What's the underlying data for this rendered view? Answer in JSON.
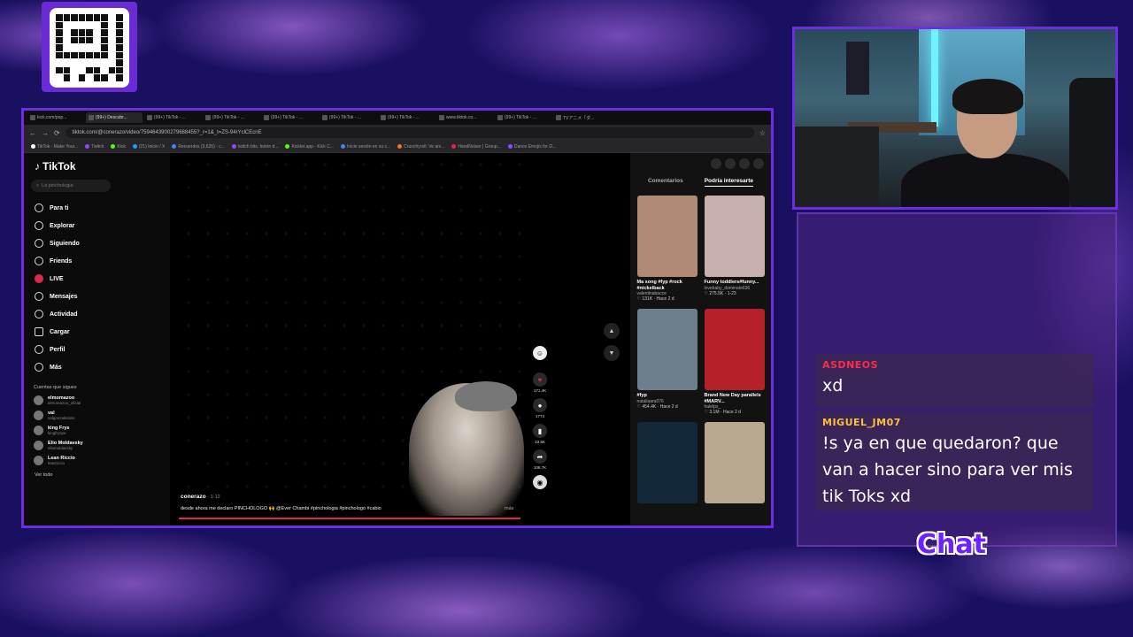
{
  "browser": {
    "tabs": [
      {
        "label": "kick.com/pop..."
      },
      {
        "label": "(99+) Descubr..."
      },
      {
        "label": "(99+) TikTok - ..."
      },
      {
        "label": "(99+) TikTok - ..."
      },
      {
        "label": "(99+) TikTok - ..."
      },
      {
        "label": "(99+) TikTok - ..."
      },
      {
        "label": "(99+) TikTok - ..."
      },
      {
        "label": "www.tiktok.co..."
      },
      {
        "label": "(99+) TikTok - ..."
      },
      {
        "label": "TVアニメ「ダ..."
      }
    ],
    "url": "tiktok.com/@conerazo/video/7594643900279688455?_r=1&_t=ZS-94rYclCEcnE",
    "bookmarks": [
      "TikTok - Make Your...",
      "Twitch",
      "Kick",
      "(21) Inicio / X",
      "Recuerdos (3,626) - c...",
      "twitch bits: botón d...",
      "Kicklet.app - Kick C...",
      "Inicie sesión en su c...",
      "Crunchyroll: Ve ani...",
      "HandNoiser | Group...",
      "Dance Emojis for D..."
    ]
  },
  "tiktok": {
    "logo": "TikTok",
    "search_placeholder": "La pinchologia",
    "menu": [
      {
        "label": "Para ti",
        "icon": "home-icon"
      },
      {
        "label": "Explorar",
        "icon": "compass-icon"
      },
      {
        "label": "Siguiendo",
        "icon": "following-icon"
      },
      {
        "label": "Friends",
        "icon": "friends-icon"
      },
      {
        "label": "LIVE",
        "icon": "live-icon"
      },
      {
        "label": "Mensajes",
        "icon": "messages-icon"
      },
      {
        "label": "Actividad",
        "icon": "activity-icon"
      },
      {
        "label": "Cargar",
        "icon": "upload-icon"
      },
      {
        "label": "Perfil",
        "icon": "profile-icon"
      },
      {
        "label": "Más",
        "icon": "more-icon"
      }
    ],
    "following_header": "Cuentas que sigues",
    "following": [
      {
        "name": "elmomazoo",
        "handle": "elmomazoo_oficial"
      },
      {
        "name": "val",
        "handle": "valgonzalessss"
      },
      {
        "name": "king Frys",
        "handle": "kingfryspe"
      },
      {
        "name": "Elio Moldavsky",
        "handle": "eliomoldavsky"
      },
      {
        "name": "Lean Riccio",
        "handle": "leanriccio"
      }
    ],
    "see_all": "Ver todo",
    "video": {
      "author": "conerazo",
      "date": "· 1-12",
      "caption": "desde ahora me declaro PINCHOLOGO 🙌 @Ever Chambi #pinchologia #pinchologo #cabio",
      "more": "más",
      "progress": 1.0,
      "likes": "171.4K",
      "comments": "1774",
      "saves": "33.5K",
      "shares": "108.7K"
    },
    "right_tabs": [
      "Comentarios",
      "Podría interesarte"
    ],
    "recommended": [
      {
        "title": "Ma song #fyp #rock #nickelback",
        "user": "valentinabacce",
        "likes": "131K",
        "age": "Hace 2 d",
        "color": "#b08a74"
      },
      {
        "title": "Funny toddlers#funny...",
        "user": "lovebaby_dominate636",
        "likes": "275.5K",
        "age": "1-23",
        "color": "#c7b0ad"
      },
      {
        "title": "#fyp",
        "user": "nataliaara076",
        "likes": "454.4K",
        "age": "Hace 2 d",
        "color": "#6e7f8c"
      },
      {
        "title": "Brand New Day parallels #MARV...",
        "user": "halelps_",
        "likes": "3.1M",
        "age": "Hace 2 d",
        "color": "#b5202a"
      },
      {
        "title": "",
        "user": "",
        "likes": "",
        "age": "",
        "color": "#14283c"
      },
      {
        "title": "",
        "user": "",
        "likes": "",
        "age": "",
        "color": "#b8a890"
      }
    ]
  },
  "chat": {
    "messages": [
      {
        "user": "ASDNEOS",
        "user_color": "#ff2b4b",
        "text": "xd"
      },
      {
        "user": "MIGUEL_JM07",
        "user_color": "#ffbf3a",
        "text": "!s ya en que quedaron? que van a hacer sino para ver mis tik Toks xd"
      }
    ],
    "label": "Chat"
  }
}
